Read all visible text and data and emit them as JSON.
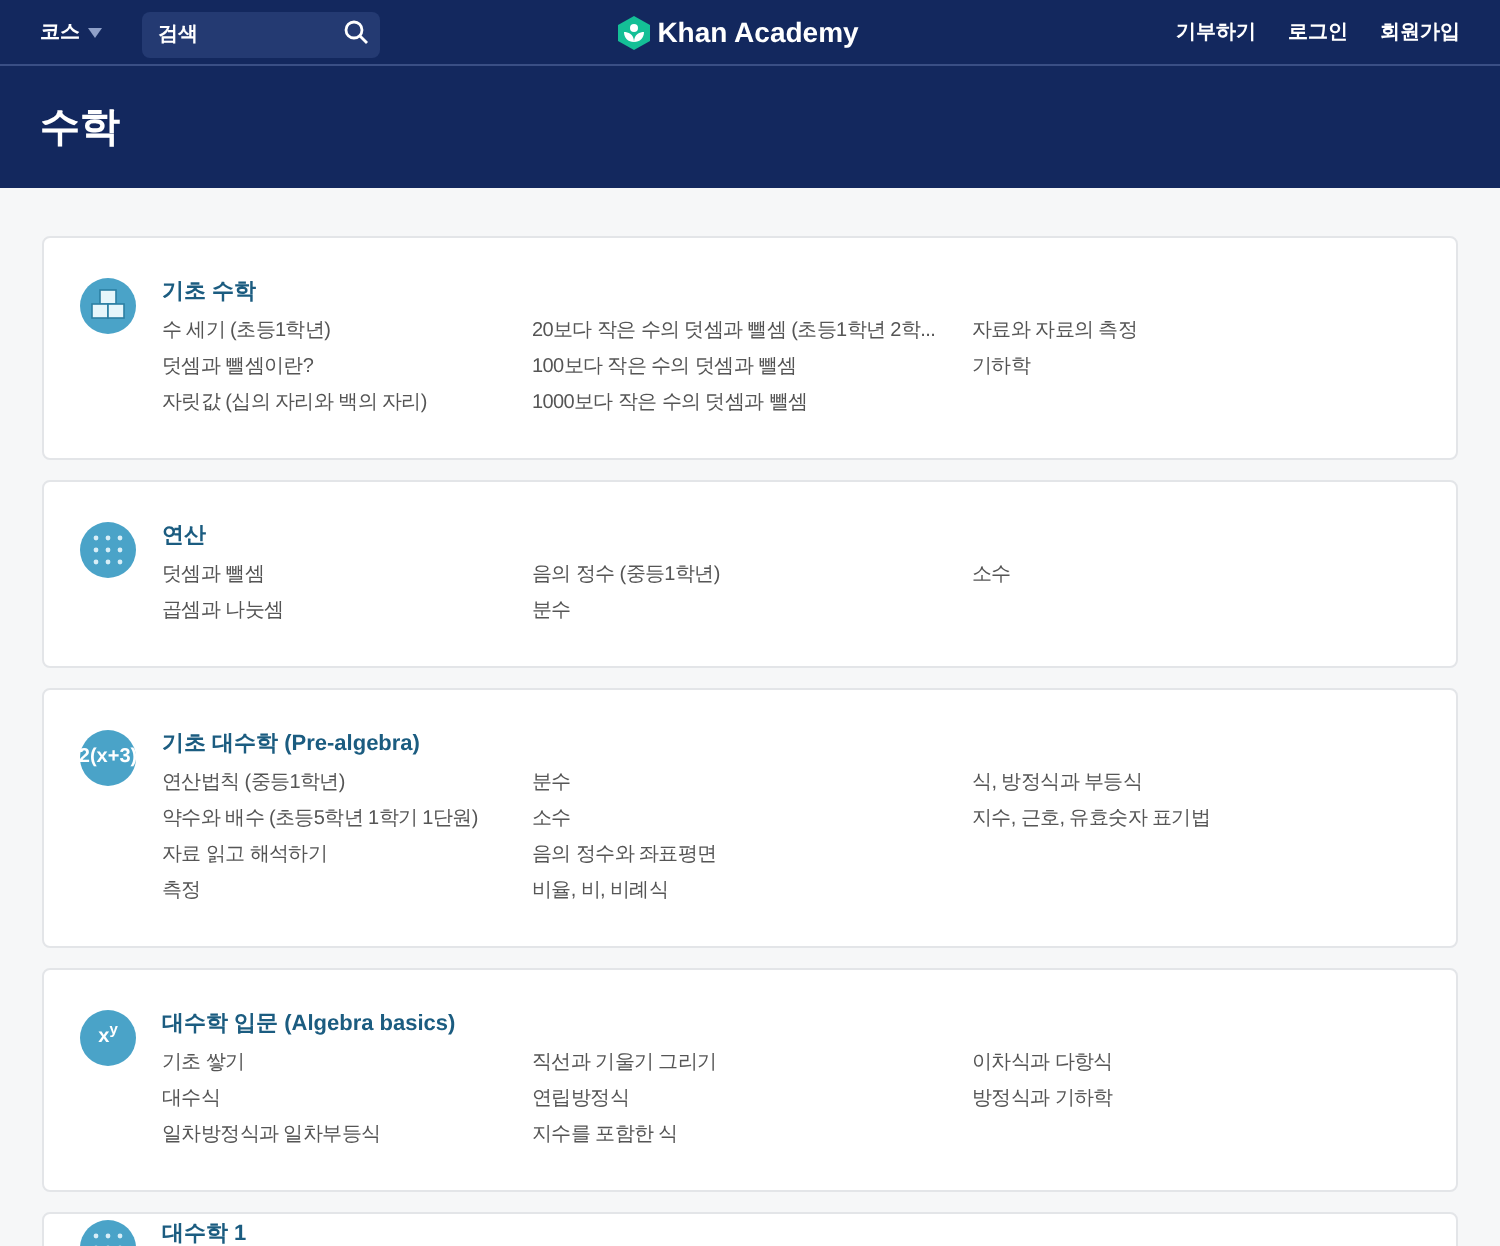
{
  "nav": {
    "courses": "코스",
    "search": {
      "placeholder": "검색"
    },
    "logo": "Khan Academy",
    "links": [
      "기부하기",
      "로그인",
      "회원가입"
    ]
  },
  "header": {
    "title": "수학"
  },
  "subjects": [
    {
      "title": "기초 수학",
      "icon": {
        "kind": "cubes"
      },
      "columns": [
        [
          "수 세기 (초등1학년)",
          "덧셈과 뺄셈이란?",
          "자릿값 (십의 자리와 백의 자리)"
        ],
        [
          "20보다 작은 수의 덧셈과 뺄셈 (초등1학년 2학...",
          "100보다 작은 수의 덧셈과 뺄셈",
          "1000보다 작은 수의 덧셈과 뺄셈"
        ],
        [
          "자료와 자료의 측정",
          "기하학"
        ]
      ]
    },
    {
      "title": "연산",
      "icon": {
        "kind": "symbols"
      },
      "columns": [
        [
          "덧셈과 뺄셈",
          "곱셈과 나눗셈"
        ],
        [
          "음의 정수 (중등1학년)",
          "분수"
        ],
        [
          "소수"
        ]
      ]
    },
    {
      "title": "기초 대수학 (Pre-algebra)",
      "icon": {
        "kind": "text",
        "text": "2(x+3)"
      },
      "columns": [
        [
          "연산법칙 (중등1학년)",
          "약수와 배수 (초등5학년 1학기 1단원)",
          "자료 읽고 해석하기",
          "측정"
        ],
        [
          "분수",
          "소수",
          "음의 정수와 좌표평면",
          "비율, 비, 비례식"
        ],
        [
          "식, 방정식과 부등식",
          "지수, 근호, 유효숫자 표기법"
        ]
      ]
    },
    {
      "title": "대수학 입문 (Algebra basics)",
      "icon": {
        "kind": "text",
        "text": "x$^{y}$"
      },
      "columns": [
        [
          "기초 쌓기",
          "대수식",
          "일차방정식과 일차부등식"
        ],
        [
          "직선과 기울기 그리기",
          "연립방정식",
          "지수를 포함한 식"
        ],
        [
          "이차식과 다항식",
          "방정식과 기하학"
        ]
      ]
    },
    {
      "title": "대수학 1",
      "icon": {
        "kind": "symbols"
      }
    }
  ]
}
